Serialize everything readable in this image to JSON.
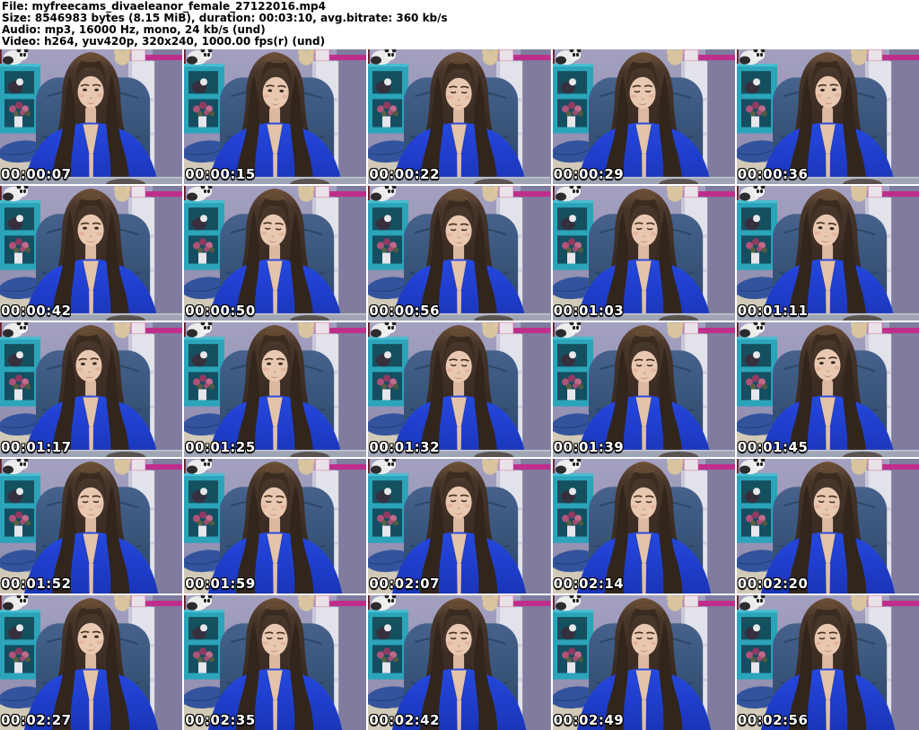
{
  "header": {
    "lines": [
      "File: myfreecams_divaeleanor_female_27122016.mp4",
      "Size: 8546983 bytes (8.15 MiB), duration: 00:03:10, avg.bitrate: 360 kb/s",
      "Audio: mp3, 16000 Hz, mono, 24 kb/s (und)",
      "Video: h264, yuv420p, 320x240, 1000.00 fps(r) (und)"
    ]
  },
  "colors": {
    "wall": "#9997b8",
    "teal_shelf": "#2ba4ba",
    "chair": "#3a5a84",
    "blouse": "#2244d8",
    "magenta_stripe": "#bf2e8a",
    "timestamp_text": "#ffffff",
    "timestamp_outline": "#000000"
  },
  "thumbnails": [
    {
      "timestamp": "00:00:07",
      "gaze": "camera",
      "head_tilt": 0,
      "head_dx": 0,
      "head_dy": 0,
      "desk_visible": true
    },
    {
      "timestamp": "00:00:15",
      "gaze": "camera",
      "head_tilt": 2,
      "head_dx": 1,
      "head_dy": 1,
      "desk_visible": true
    },
    {
      "timestamp": "00:00:22",
      "gaze": "down",
      "head_tilt": 1,
      "head_dx": 0,
      "head_dy": 2,
      "desk_visible": true
    },
    {
      "timestamp": "00:00:29",
      "gaze": "down",
      "head_tilt": -1,
      "head_dx": -1,
      "head_dy": 1,
      "desk_visible": true
    },
    {
      "timestamp": "00:00:36",
      "gaze": "camera",
      "head_tilt": -2,
      "head_dx": 1,
      "head_dy": 0,
      "desk_visible": true
    },
    {
      "timestamp": "00:00:42",
      "gaze": "camera",
      "head_tilt": 0,
      "head_dx": 0,
      "head_dy": 2,
      "desk_visible": true
    },
    {
      "timestamp": "00:00:50",
      "gaze": "down",
      "head_tilt": 3,
      "head_dx": -2,
      "head_dy": 2,
      "desk_visible": true
    },
    {
      "timestamp": "00:00:56",
      "gaze": "down",
      "head_tilt": 0,
      "head_dx": 0,
      "head_dy": 3,
      "desk_visible": true
    },
    {
      "timestamp": "00:01:03",
      "gaze": "down",
      "head_tilt": 1,
      "head_dx": 1,
      "head_dy": 2,
      "desk_visible": true
    },
    {
      "timestamp": "00:01:11",
      "gaze": "camera",
      "head_tilt": 4,
      "head_dx": -2,
      "head_dy": 2,
      "desk_visible": true
    },
    {
      "timestamp": "00:01:17",
      "gaze": "camera",
      "head_tilt": -2,
      "head_dx": -2,
      "head_dy": 1,
      "desk_visible": true
    },
    {
      "timestamp": "00:01:25",
      "gaze": "camera",
      "head_tilt": 0,
      "head_dx": 0,
      "head_dy": 1,
      "desk_visible": true
    },
    {
      "timestamp": "00:01:32",
      "gaze": "down",
      "head_tilt": 2,
      "head_dx": 0,
      "head_dy": 2,
      "desk_visible": true
    },
    {
      "timestamp": "00:01:39",
      "gaze": "down",
      "head_tilt": 0,
      "head_dx": 1,
      "head_dy": 2,
      "desk_visible": true
    },
    {
      "timestamp": "00:01:45",
      "gaze": "camera",
      "head_tilt": -3,
      "head_dx": 0,
      "head_dy": 0,
      "desk_visible": true
    },
    {
      "timestamp": "00:01:52",
      "gaze": "down",
      "head_tilt": -1,
      "head_dx": 0,
      "head_dy": 2,
      "desk_visible": false
    },
    {
      "timestamp": "00:01:59",
      "gaze": "down",
      "head_tilt": 2,
      "head_dx": -1,
      "head_dy": 2,
      "desk_visible": false
    },
    {
      "timestamp": "00:02:07",
      "gaze": "down",
      "head_tilt": 0,
      "head_dx": 0,
      "head_dy": 1,
      "desk_visible": false
    },
    {
      "timestamp": "00:02:14",
      "gaze": "down",
      "head_tilt": 1,
      "head_dx": 0,
      "head_dy": 2,
      "desk_visible": false
    },
    {
      "timestamp": "00:02:20",
      "gaze": "down",
      "head_tilt": 2,
      "head_dx": -1,
      "head_dy": 2,
      "desk_visible": false
    },
    {
      "timestamp": "00:02:27",
      "gaze": "camera",
      "head_tilt": 0,
      "head_dx": 0,
      "head_dy": 1,
      "desk_visible": false
    },
    {
      "timestamp": "00:02:35",
      "gaze": "down",
      "head_tilt": 1,
      "head_dx": 0,
      "head_dy": 2,
      "desk_visible": false
    },
    {
      "timestamp": "00:02:42",
      "gaze": "down",
      "head_tilt": 0,
      "head_dx": 0,
      "head_dy": 2,
      "desk_visible": false
    },
    {
      "timestamp": "00:02:49",
      "gaze": "down",
      "head_tilt": 1,
      "head_dx": 1,
      "head_dy": 2,
      "desk_visible": false
    },
    {
      "timestamp": "00:02:56",
      "gaze": "down",
      "head_tilt": -1,
      "head_dx": 0,
      "head_dy": 2,
      "desk_visible": false
    }
  ]
}
